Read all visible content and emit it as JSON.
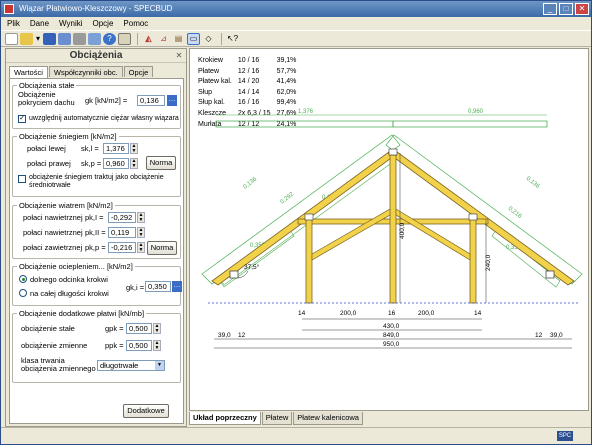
{
  "window": {
    "title": "Wiązar Płatwiowo-Kleszczowy - SPECBUD"
  },
  "menu": [
    "Plik",
    "Dane",
    "Wyniki",
    "Opcje",
    "Pomoc"
  ],
  "panel": {
    "title": "Obciążenia",
    "tabs": [
      "Wartości",
      "Współczynniki obc.",
      "Opcje"
    ],
    "stale": {
      "group": "Obciążenia stałe",
      "pokrycie_label": "Obciążenie pokryciem dachu",
      "pokrycie_symbol": "gk [kN/m2] =",
      "pokrycie_value": "0,136",
      "ciezar_check": "uwzględnij automatycznie ciężar własny wiązara"
    },
    "snieg": {
      "group": "Obciążenie śniegiem [kN/m2]",
      "lewa_label": "połaci lewej",
      "lewa_symbol": "sk,l =",
      "lewa_value": "1,376",
      "prawa_label": "połaci prawej",
      "prawa_symbol": "sk,p =",
      "prawa_value": "0,960",
      "norma_button": "Norma",
      "check_label": "obciążenie śniegiem traktuj jako obciążenie średniotrwałe"
    },
    "wiatr": {
      "group": "Obciążenie wiatrem [kN/m2]",
      "nawietrzna1_label": "połaci nawietrznej",
      "nawietrzna1_symbol": "pk,I =",
      "nawietrzna1_value": "-0,292",
      "nawietrzna2_label": "połaci nawietrznej",
      "nawietrzna2_symbol": "pk,II =",
      "nawietrzna2_value": "0,119",
      "zawietrzna_label": "połaci zawietrznej",
      "zawietrzna_symbol": "pk,p =",
      "zawietrzna_value": "-0,216",
      "norma_button": "Norma"
    },
    "ocieplenie": {
      "group": "Obciążenie ociepleniem... [kN/m2]",
      "radio1": "dolnego odcinka krokwi",
      "radio2": "na całej długości krokwi",
      "symbol": "gk,i =",
      "value": "0,350"
    },
    "dodatkowe": {
      "group": "Obciążenie dodatkowe płatwi [kN/mb]",
      "stale_label": "obciążenie stałe",
      "stale_symbol": "gpk =",
      "stale_value": "0,500",
      "zmienne_label": "obciążenie zmienne",
      "zmienne_symbol": "ppk =",
      "zmienne_value": "0,500",
      "klasa_label": "klasa trwania obciążenia zmiennego",
      "klasa_value": "długotrwałe"
    },
    "dodatkowe_button": "Dodatkowe"
  },
  "stats": [
    [
      "Krokiew",
      "10 / 16",
      "39,1%"
    ],
    [
      "Płatew",
      "12 / 16",
      "57,7%"
    ],
    [
      "Płatew kal.",
      "14 / 20",
      "41,4%"
    ],
    [
      "Słup",
      "14 / 14",
      "62,0%"
    ],
    [
      "Słup kal.",
      "16 / 16",
      "99,4%"
    ],
    [
      "Kleszcze",
      "2x 6,3 / 15",
      "27,6%"
    ],
    [
      "Murłata",
      "12 / 12",
      "24,1%"
    ]
  ],
  "drawing": {
    "snow_left": "1,376",
    "snow_right": "0,960",
    "dead_left": "0,136",
    "dead_right": "0,136",
    "insul_left": "0,350",
    "insul_right": "0,350",
    "wind_left": "0,292",
    "wind_right": "0,216",
    "wind_small_left": "0,119",
    "angle": "37,5°",
    "post_height": "400,0",
    "right_height": "240,0",
    "dim_14_l": "14",
    "dim_200_l": "200,0",
    "dim_16": "16",
    "dim_200_r": "200,0",
    "dim_14_r": "14",
    "dim_430": "430,0",
    "dim_39_l": "39,0",
    "dim_12_l": "12",
    "dim_849": "849,0",
    "dim_12_r": "12",
    "dim_39_r": "39,0",
    "dim_950": "950,0"
  },
  "bottom_tabs": [
    "Układ poprzeczny",
    "Płatew",
    "Płatew kalenicowa"
  ],
  "status": {
    "logo": "SPC"
  }
}
